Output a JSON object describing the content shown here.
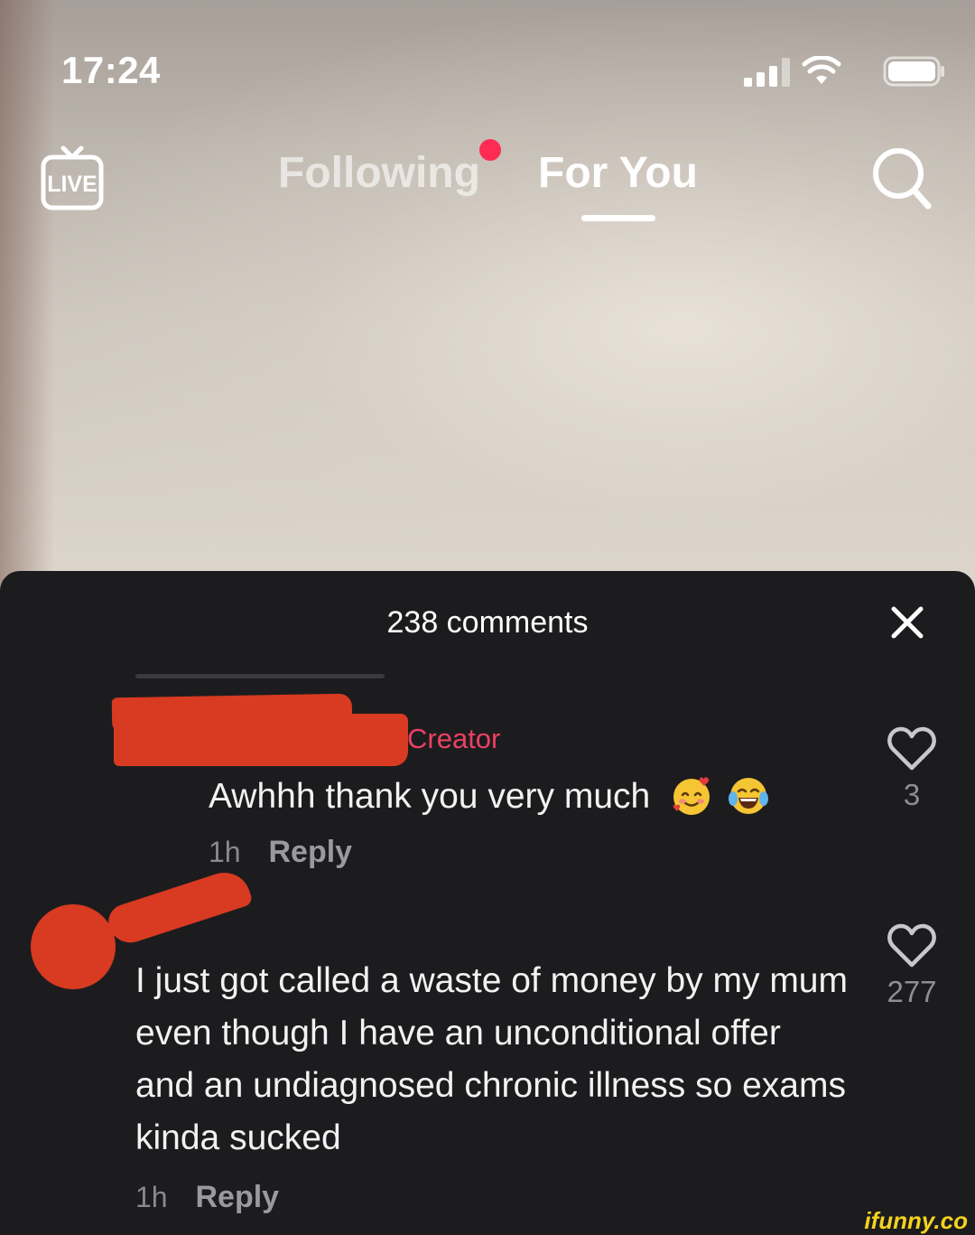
{
  "status_bar": {
    "time": "17:24"
  },
  "top_nav": {
    "live_label": "LIVE",
    "tabs": [
      {
        "label": "Following",
        "active": false,
        "has_dot": true
      },
      {
        "label": "For You",
        "active": true
      }
    ]
  },
  "comments_sheet": {
    "title": "238 comments",
    "comments": [
      {
        "badge": "Creator",
        "text": "Awhhh thank you very much",
        "emojis": [
          "smiling-face-with-hearts",
          "face-with-tears-of-joy"
        ],
        "time": "1h",
        "reply_label": "Reply",
        "likes": "3"
      },
      {
        "text": "I just got called a waste of money by my mum even though I have an unconditional offer and an undiagnosed chronic illness so exams kinda sucked",
        "time": "1h",
        "reply_label": "Reply",
        "likes": "277"
      }
    ]
  },
  "watermark": "ifunny.co",
  "colors": {
    "accent": "#fe2c55",
    "creator_label": "#ea4163",
    "redaction": "#d83a22",
    "sheet_bg": "#1c1c1e"
  }
}
